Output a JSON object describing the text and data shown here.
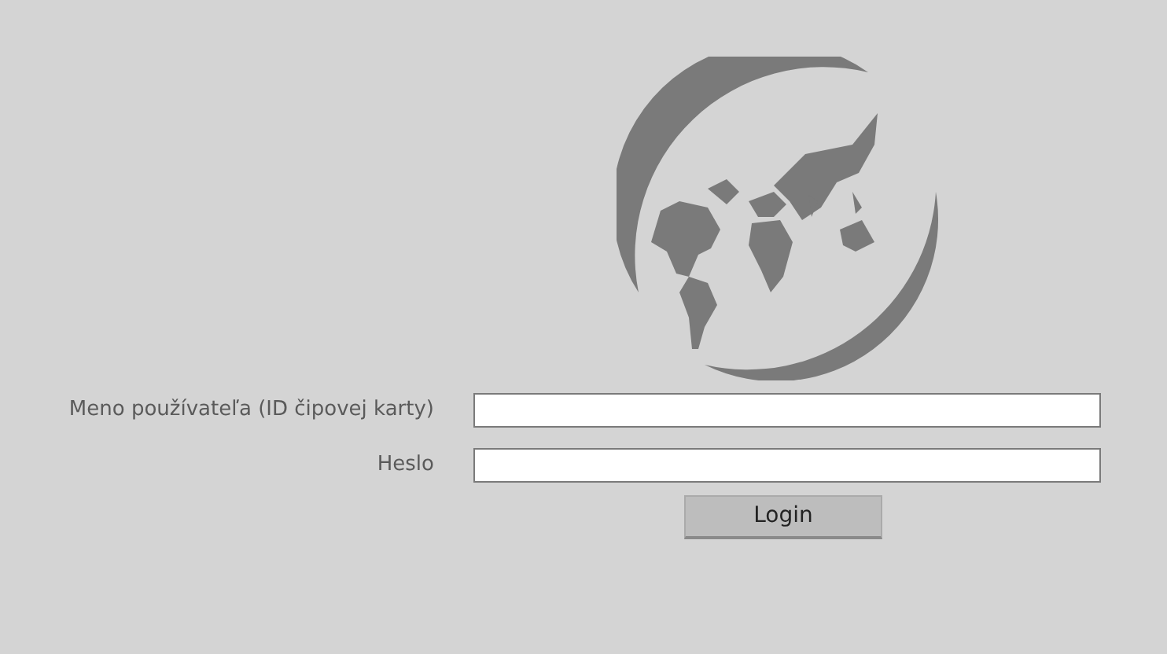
{
  "fields": [
    {
      "label": "Meno používateľa (ID čipovej karty)"
    },
    {
      "label": "Heslo"
    }
  ],
  "login_button": {
    "label": "Login"
  }
}
